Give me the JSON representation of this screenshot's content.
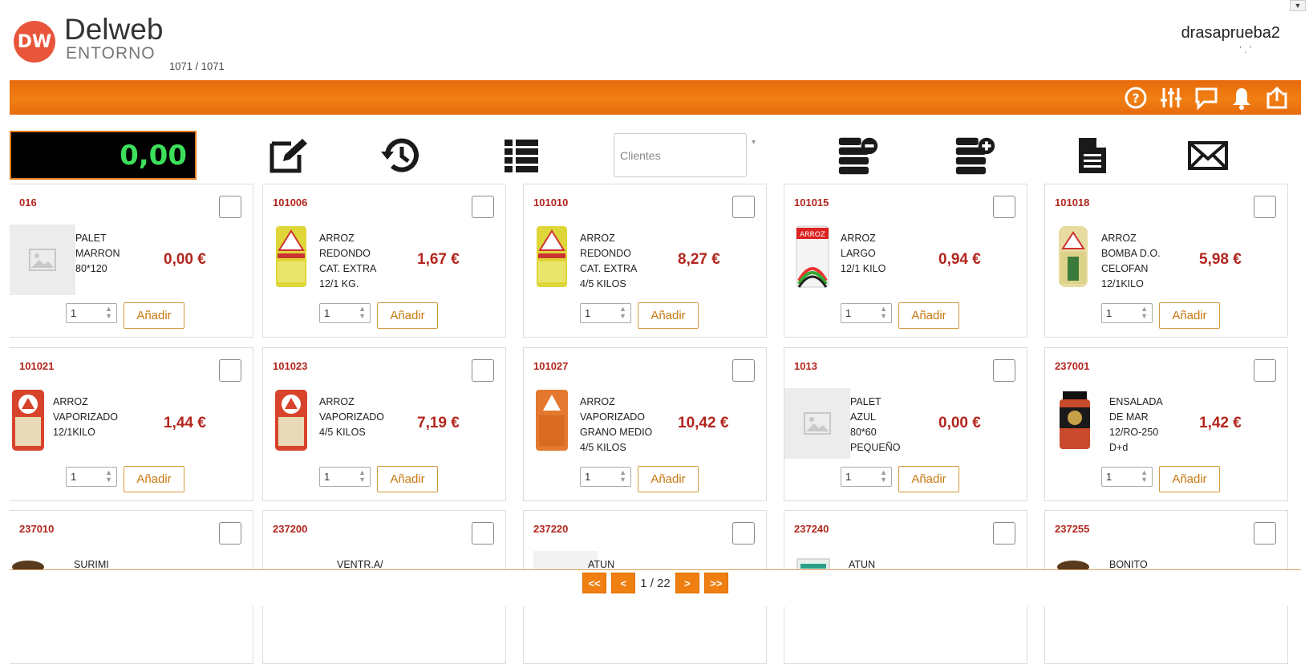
{
  "header": {
    "logo_text": "DW",
    "brand": "Delweb",
    "brand_sub": "ENTORNO",
    "counter": "1071 / 1071",
    "user": "drasaprueba2",
    "user_sub": "'       .       '",
    "corner_arrow": "▼"
  },
  "toolbar": {
    "icons": [
      "help-icon",
      "sliders-icon",
      "chat-icon",
      "bell-icon",
      "export-icon"
    ],
    "total": "0,00",
    "clientes_placeholder": "Clientes",
    "caret": "▾",
    "tools": [
      "edit-icon",
      "history-icon",
      "list-icon",
      "server-remove-icon",
      "server-add-icon",
      "document-icon",
      "mail-icon"
    ]
  },
  "colors": {
    "accent": "#f07f12",
    "price": "#b3261e",
    "total_text": "#3de05a"
  },
  "products": [
    {
      "code": "016",
      "desc": "PALET\nMARRON\n80*120",
      "price": "0,00 €",
      "qty": "1",
      "add": "Añadir",
      "img": "placeholder"
    },
    {
      "code": "101006",
      "desc": "ARROZ\nREDONDO\nCAT. EXTRA\n12/1 KG.",
      "price": "1,67 €",
      "qty": "1",
      "add": "Añadir",
      "img": "yellow-bag"
    },
    {
      "code": "101010",
      "desc": "ARROZ\nREDONDO\nCAT. EXTRA\n4/5 KILOS",
      "price": "8,27 €",
      "qty": "1",
      "add": "Añadir",
      "img": "yellow-bag"
    },
    {
      "code": "101015",
      "desc": "ARROZ\nLARGO\n12/1 KILO",
      "price": "0,94 €",
      "qty": "1",
      "add": "Añadir",
      "img": "white-bag"
    },
    {
      "code": "101018",
      "desc": "ARROZ\nBOMBA D.O.\nCELOFAN\n12/1KILO",
      "price": "5,98 €",
      "qty": "1",
      "add": "Añadir",
      "img": "clear-bag"
    },
    {
      "code": "101021",
      "desc": "ARROZ\nVAPORIZADO\n12/1KILO",
      "price": "1,44 €",
      "qty": "1",
      "add": "Añadir",
      "img": "red-bag"
    },
    {
      "code": "101023",
      "desc": "ARROZ\nVAPORIZADO\n4/5 KILOS",
      "price": "7,19 €",
      "qty": "1",
      "add": "Añadir",
      "img": "red-bag"
    },
    {
      "code": "101027",
      "desc": "ARROZ\nVAPORIZADO\nGRANO MEDIO\n4/5 KILOS",
      "price": "10,42 €",
      "qty": "1",
      "add": "Añadir",
      "img": "orange-bag"
    },
    {
      "code": "1013",
      "desc": "PALET\nAZUL\n80*60\nPEQUEÑO",
      "price": "0,00 €",
      "qty": "1",
      "add": "Añadir",
      "img": "placeholder"
    },
    {
      "code": "237001",
      "desc": "ENSALADA\nDE MAR\n12/RO-250\nD+d",
      "price": "1,42 €",
      "qty": "1",
      "add": "Añadir",
      "img": "jar"
    },
    {
      "code": "237010",
      "desc": "SURIMI",
      "price": "",
      "qty": "",
      "add": "",
      "img": "dark"
    },
    {
      "code": "237200",
      "desc": "VENTR.A/",
      "price": "",
      "qty": "",
      "add": "",
      "img": "none"
    },
    {
      "code": "237220",
      "desc": "ATUN",
      "price": "",
      "qty": "",
      "add": "",
      "img": "light"
    },
    {
      "code": "237240",
      "desc": "ATUN",
      "price": "",
      "qty": "",
      "add": "",
      "img": "can"
    },
    {
      "code": "237255",
      "desc": "BONITO",
      "price": "",
      "qty": "",
      "add": "",
      "img": "dark"
    }
  ],
  "pager": {
    "first": "<<",
    "prev": "<",
    "page": "1 / 22",
    "next": ">",
    "last": ">>"
  }
}
